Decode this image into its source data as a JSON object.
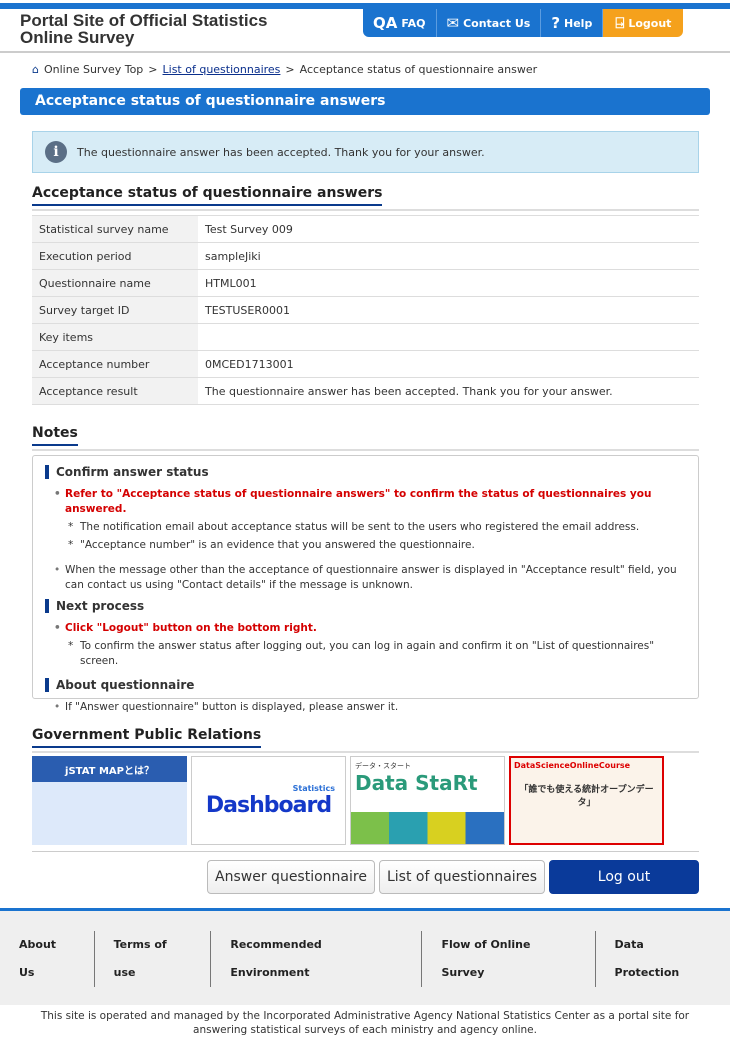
{
  "header": {
    "title_line1": "Portal Site of Official Statistics",
    "title_line2": "Online Survey",
    "nav": [
      {
        "label": "FAQ",
        "icon": "qa-icon"
      },
      {
        "label": "Contact Us",
        "icon": "mail-icon"
      },
      {
        "label": "Help",
        "icon": "question-icon"
      },
      {
        "label": "Logout",
        "icon": "logout-door-icon"
      }
    ]
  },
  "breadcrumb": {
    "home": "Online Survey Top",
    "sep": ">",
    "list": "List of questionnaires",
    "current": "Acceptance status of questionnaire answer"
  },
  "page_title": "Acceptance status of questionnaire answers",
  "info_message": "The questionnaire answer has been accepted. Thank you for your answer.",
  "status": {
    "heading": "Acceptance status of questionnaire answers",
    "rows": [
      {
        "k": "Statistical survey name",
        "v": "Test Survey 009"
      },
      {
        "k": "Execution period",
        "v": "sampleJiki"
      },
      {
        "k": "Questionnaire name",
        "v": "HTML001"
      },
      {
        "k": "Survey target ID",
        "v": "TESTUSER0001"
      },
      {
        "k": "Key items",
        "v": ""
      },
      {
        "k": "Acceptance number",
        "v": "0MCED1713001"
      },
      {
        "k": "Acceptance result",
        "v": "The questionnaire answer has been accepted. Thank you for your answer."
      }
    ]
  },
  "notes": {
    "heading": "Notes",
    "confirm_heading": "Confirm answer status",
    "confirm_red": "Refer to \"Acceptance status of questionnaire answers\" to confirm the status of questionnaires you answered.",
    "confirm_sub1": "The notification email about acceptance status will be sent to the users who registered the email address.",
    "confirm_sub2": "\"Acceptance number\" is an evidence that you answered the questionnaire.",
    "confirm_other": "When the message other than the acceptance of questionnaire answer is displayed in \"Acceptance result\" field, you can contact us using \"Contact details\" if the message is unknown.",
    "next_heading": "Next process",
    "next_red": "Click \"Logout\" button on the bottom right.",
    "next_sub": "To confirm the answer status after logging out, you can log in again and confirm it on \"List of questionnaires\" screen.",
    "about_heading": "About questionnaire",
    "about_text": "If \"Answer questionnaire\" button is displayed, please answer it."
  },
  "pr": {
    "heading": "Government Public Relations",
    "banners": [
      {
        "text": "jSTAT MAPとは？"
      },
      {
        "text": "Dashboard",
        "sub": "Statistics"
      },
      {
        "text": "Data StaRt",
        "sub": "データ・スタート"
      },
      {
        "text": "「誰でも使える統計オープンデータ」",
        "sub": "DataScienceOnlineCourse"
      }
    ]
  },
  "buttons": {
    "answer": "Answer questionnaire",
    "list": "List of questionnaires",
    "logout": "Log out"
  },
  "footer": {
    "links": [
      "About Us",
      "Terms of use",
      "Recommended Environment",
      "Flow of Online Survey",
      "Data Protection"
    ],
    "text": "This site is operated and managed by the Incorporated Administrative Agency National Statistics Center as a portal site for answering statistical surveys of each ministry and agency online."
  },
  "colors": {
    "primary": "#1a73cf",
    "logout": "#f5a11c",
    "dark": "#0a3a8c",
    "alert": "#d40000"
  }
}
